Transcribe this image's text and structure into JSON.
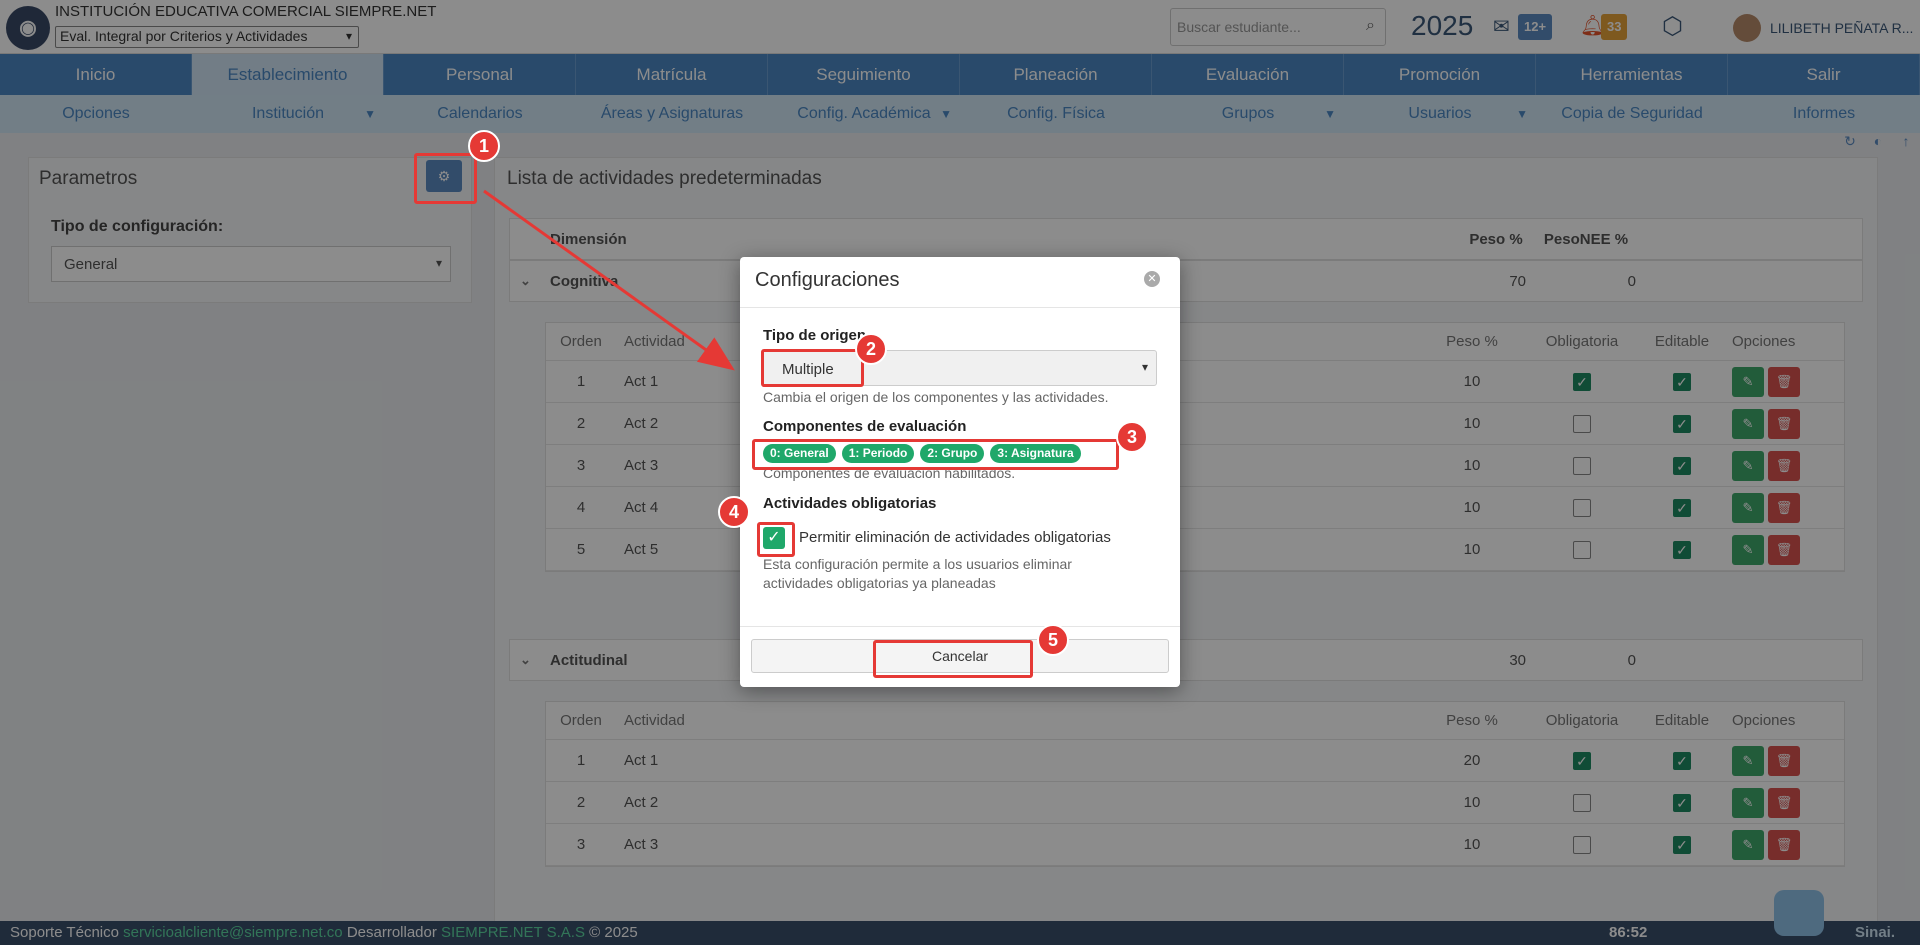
{
  "header": {
    "institution": "INSTITUCIÓN EDUCATIVA COMERCIAL SIEMPRE.NET",
    "mode_select": "Eval. Integral por Criterios y Actividades",
    "search_placeholder": "Buscar estudiante...",
    "year": "2025",
    "messages_badge": "12+",
    "notifications_badge": "33",
    "user_name": "LILIBETH PEÑATA R..."
  },
  "main_nav": [
    "Inicio",
    "Establecimiento",
    "Personal",
    "Matrícula",
    "Seguimiento",
    "Planeación",
    "Evaluación",
    "Promoción",
    "Herramientas",
    "Salir"
  ],
  "sub_nav": [
    {
      "label": "Opciones",
      "dropdown": false
    },
    {
      "label": "Institución",
      "dropdown": true
    },
    {
      "label": "Calendarios",
      "dropdown": false
    },
    {
      "label": "Áreas y Asignaturas",
      "dropdown": false
    },
    {
      "label": "Config. Académica",
      "dropdown": true
    },
    {
      "label": "Config. Física",
      "dropdown": false
    },
    {
      "label": "Grupos",
      "dropdown": true
    },
    {
      "label": "Usuarios",
      "dropdown": true
    },
    {
      "label": "Copia de Seguridad",
      "dropdown": false
    },
    {
      "label": "Informes",
      "dropdown": false
    }
  ],
  "params": {
    "title": "Parametros",
    "config_type_label": "Tipo de configuración:",
    "config_type_value": "General"
  },
  "activities": {
    "title": "Lista de actividades predeterminadas",
    "headers": {
      "dimension": "Dimensión",
      "weight": "Peso %",
      "weight_nee": "PesoNEE %"
    },
    "table_headers": {
      "order": "Orden",
      "activity": "Actividad",
      "weight": "Peso %",
      "mandatory": "Obligatoria",
      "editable": "Editable",
      "options": "Opciones"
    },
    "dimensions": [
      {
        "name": "Cognitiva",
        "weight": "70",
        "weight_nee": "0",
        "rows": [
          {
            "order": "1",
            "activity": "Act 1",
            "weight": "10",
            "mandatory": true,
            "editable": true
          },
          {
            "order": "2",
            "activity": "Act 2",
            "weight": "10",
            "mandatory": false,
            "editable": true
          },
          {
            "order": "3",
            "activity": "Act 3",
            "weight": "10",
            "mandatory": false,
            "editable": true
          },
          {
            "order": "4",
            "activity": "Act 4",
            "weight": "10",
            "mandatory": false,
            "editable": true
          },
          {
            "order": "5",
            "activity": "Act 5",
            "weight": "10",
            "mandatory": false,
            "editable": true
          }
        ]
      },
      {
        "name": "Actitudinal",
        "weight": "30",
        "weight_nee": "0",
        "rows": [
          {
            "order": "1",
            "activity": "Act 1",
            "weight": "20",
            "mandatory": true,
            "editable": true
          },
          {
            "order": "2",
            "activity": "Act 2",
            "weight": "10",
            "mandatory": false,
            "editable": true
          },
          {
            "order": "3",
            "activity": "Act 3",
            "weight": "10",
            "mandatory": false,
            "editable": true
          }
        ]
      }
    ]
  },
  "modal": {
    "title": "Configuraciones",
    "origin_label": "Tipo de origen",
    "origin_value": "Multiple",
    "origin_help": "Cambia el origen de los componentes y las actividades.",
    "components_label": "Componentes de evaluación",
    "components": [
      "0: General",
      "1: Periodo",
      "2: Grupo",
      "3: Asignatura"
    ],
    "components_help": "Componentes de evaluación habilitados.",
    "mandatory_label": "Actividades obligatorias",
    "mandatory_checkbox_label": "Permitir eliminación de actividades obligatorias",
    "mandatory_checked": true,
    "mandatory_help": "Esta configuración permite a los usuarios eliminar actividades obligatorias ya planeadas",
    "cancel_label": "Cancelar"
  },
  "annotations": [
    "1",
    "2",
    "3",
    "4",
    "5"
  ],
  "footer": {
    "support_label": "Soporte Técnico",
    "support_email": "servicioalcliente@siempre.net.co",
    "dev_label": "Desarrollador",
    "dev_name": "SIEMPRE.NET S.A.S",
    "copyright": "© 2025",
    "timer": "86:52",
    "brand": "Sinai."
  },
  "colors": {
    "primary": "#4b88c3",
    "success": "#1fa86a",
    "danger": "#d9534f",
    "annotation": "#e53935"
  }
}
